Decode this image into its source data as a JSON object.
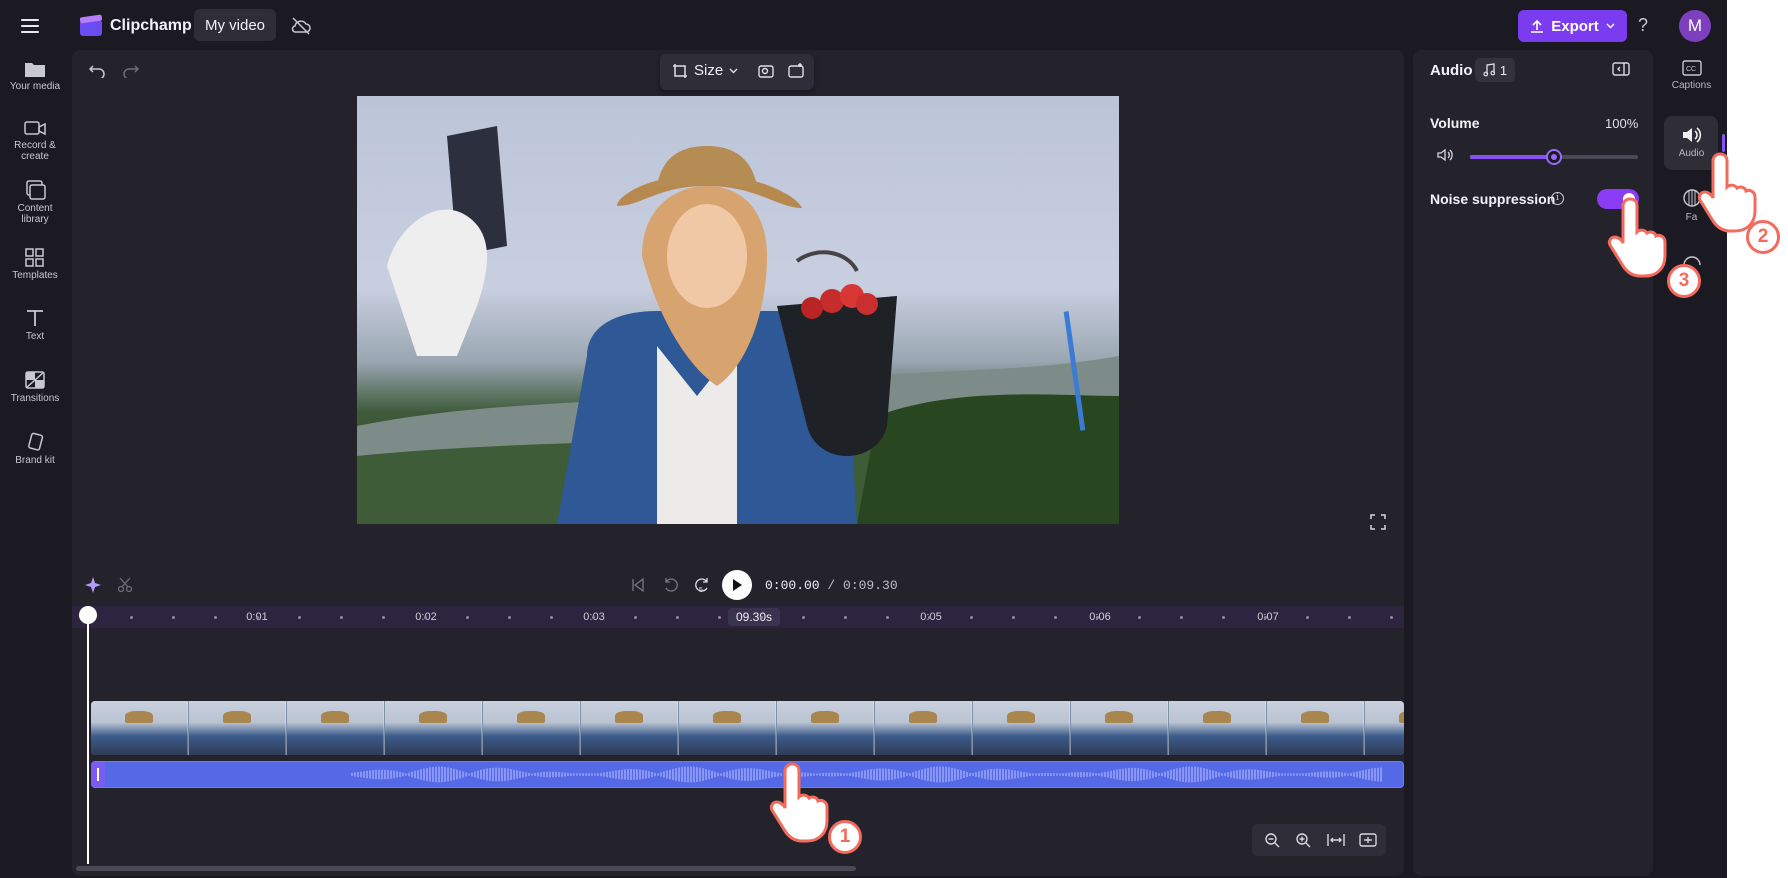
{
  "app": {
    "name": "Clipchamp",
    "project_name": "My video",
    "export_label": "Export",
    "avatar_initial": "M",
    "help_label": "?"
  },
  "left_nav": [
    {
      "label": "Your media",
      "icon": "folder-icon"
    },
    {
      "label": "Record &\ncreate",
      "icon": "camera-icon"
    },
    {
      "label": "Content\nlibrary",
      "icon": "library-icon"
    },
    {
      "label": "Templates",
      "icon": "templates-icon"
    },
    {
      "label": "Text",
      "icon": "text-icon"
    },
    {
      "label": "Transitions",
      "icon": "transitions-icon"
    },
    {
      "label": "Brand kit",
      "icon": "brand-kit-icon"
    }
  ],
  "preview": {
    "size_label": "Size"
  },
  "playback": {
    "current": "0:00.00",
    "total": "/ 0:09.30"
  },
  "timeline": {
    "ticks": [
      "0:01",
      "0:02",
      "0:03",
      "0:05",
      "0:06",
      "0:07"
    ],
    "duration_badge": "09.30s"
  },
  "audio_panel": {
    "title": "Audio",
    "track_number": "1",
    "volume_label": "Volume",
    "volume_value": "100%",
    "volume_level": 0.5,
    "noise_label": "Noise suppression",
    "noise_on": true
  },
  "right_rail": [
    {
      "label": "Captions",
      "icon": "captions-icon"
    },
    {
      "label": "Audio",
      "icon": "speaker-icon"
    },
    {
      "label": "Fa",
      "icon": "fade-icon"
    }
  ],
  "steps": [
    "1",
    "2",
    "3"
  ],
  "colors": {
    "accent": "#7b3cf0",
    "annotation": "#f46a5c",
    "audio_track": "#5568e6",
    "background": "#1b1a22"
  }
}
